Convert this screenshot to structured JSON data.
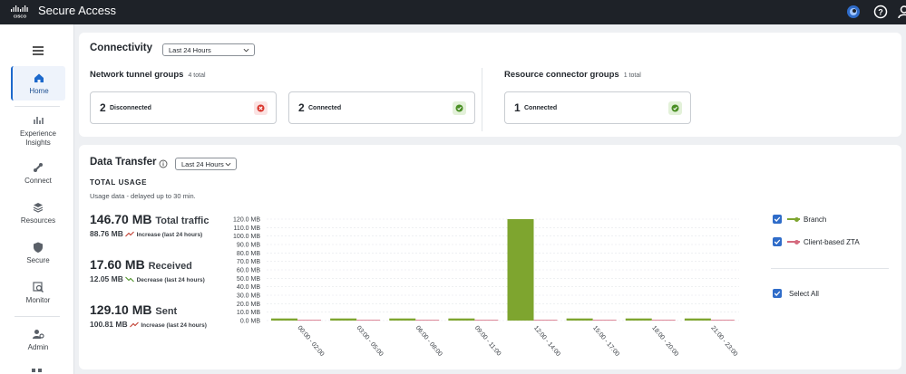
{
  "app": {
    "title": "Secure Access"
  },
  "sidebar": {
    "items": [
      {
        "label": "Home",
        "icon": "home-icon"
      },
      {
        "label": "Experience Insights",
        "icon": "insights-icon"
      },
      {
        "label": "Connect",
        "icon": "connect-icon"
      },
      {
        "label": "Resources",
        "icon": "resources-icon"
      },
      {
        "label": "Secure",
        "icon": "shield-icon"
      },
      {
        "label": "Monitor",
        "icon": "monitor-icon"
      },
      {
        "label": "Admin",
        "icon": "admin-icon"
      }
    ]
  },
  "connectivity": {
    "title": "Connectivity",
    "range": "Last 24 Hours",
    "tunnel_groups": {
      "title": "Network tunnel groups",
      "count": "4 total",
      "disconnected": {
        "num": "2",
        "label": "Disconnected"
      },
      "connected": {
        "num": "2",
        "label": "Connected"
      }
    },
    "connector_groups": {
      "title": "Resource connector groups",
      "count": "1 total",
      "connected": {
        "num": "1",
        "label": "Connected"
      }
    }
  },
  "data_transfer": {
    "title": "Data Transfer",
    "range": "Last 24 Hours",
    "usage_heading": "TOTAL USAGE",
    "usage_note": "Usage data - delayed up to 30 min.",
    "total": {
      "value": "146.70 MB",
      "label": "Total traffic",
      "sub_value": "88.76 MB",
      "trend": "Increase (last 24 hours)"
    },
    "received": {
      "value": "17.60 MB",
      "label": "Received",
      "sub_value": "12.05 MB",
      "trend": "Decrease (last 24 hours)"
    },
    "sent": {
      "value": "129.10 MB",
      "label": "Sent",
      "sub_value": "100.81 MB",
      "trend": "Increase (last 24 hours)"
    }
  },
  "legend": {
    "branch": "Branch",
    "ztа": "Client-based ZTA",
    "select_all": "Select All"
  },
  "colors": {
    "branch": "#7ea52f",
    "zta": "#d46a7e",
    "accent": "#2f6cc9"
  },
  "chart_data": {
    "type": "bar",
    "categories": [
      "00:00 - 02:00",
      "03:00 - 05:00",
      "06:00 - 08:00",
      "09:00 - 11:00",
      "12:00 - 14:00",
      "15:00 - 17:00",
      "18:00 - 20:00",
      "21:00 - 23:00"
    ],
    "series": [
      {
        "name": "Branch",
        "values": [
          2.5,
          2.5,
          2.5,
          2.5,
          120,
          2.5,
          2.5,
          2.5
        ]
      },
      {
        "name": "Client-based ZTA",
        "values": [
          0.3,
          0.3,
          0.3,
          0.3,
          0.3,
          0.3,
          0.3,
          0.3
        ]
      }
    ],
    "yticks": [
      "0.0 MB",
      "10.0 MB",
      "20.0 MB",
      "30.0 MB",
      "40.0 MB",
      "50.0 MB",
      "60.0 MB",
      "70.0 MB",
      "80.0 MB",
      "90.0 MB",
      "100.0 MB",
      "110.0 MB",
      "120.0 MB"
    ],
    "ylim": [
      0,
      120
    ]
  }
}
